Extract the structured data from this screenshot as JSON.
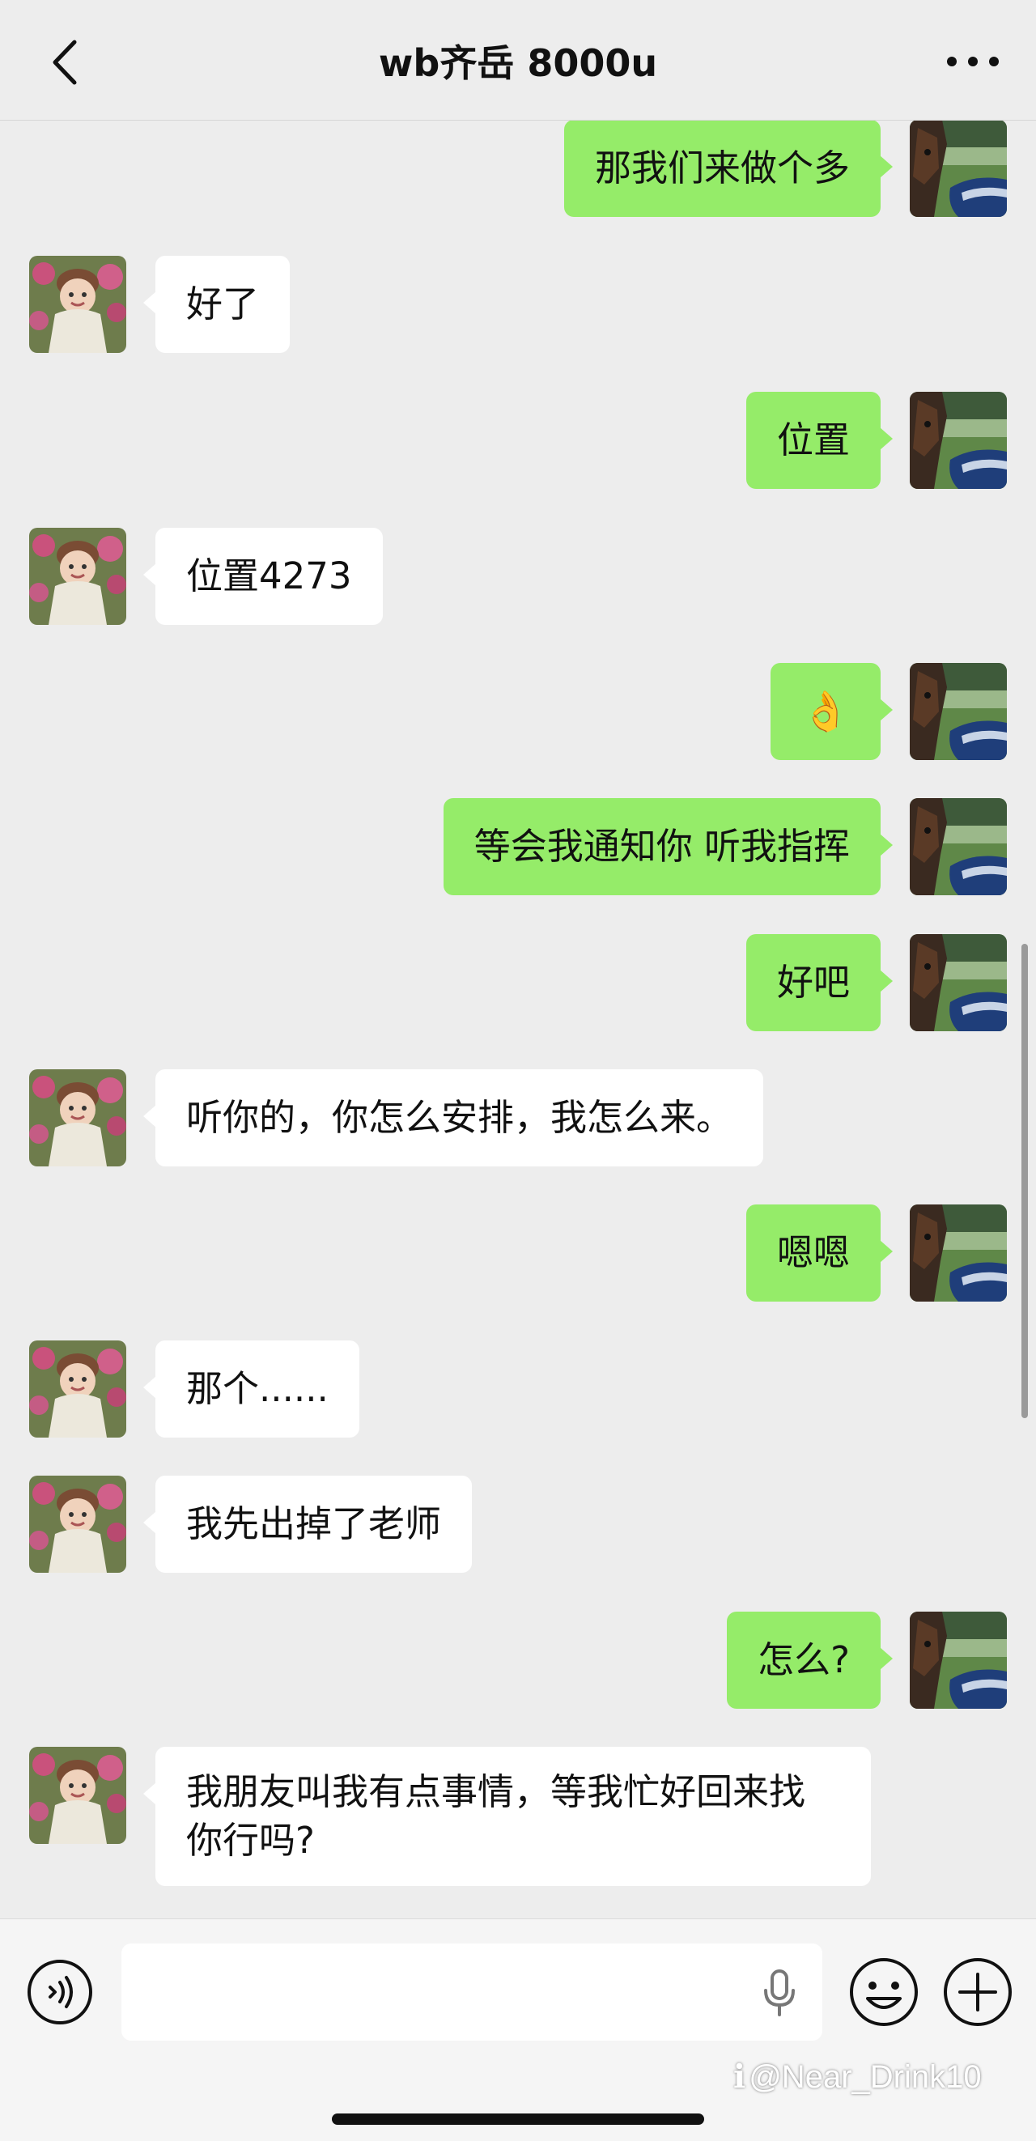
{
  "header": {
    "title": "wb齐岳 8000u"
  },
  "messages": [
    {
      "side": "right",
      "text": "那我们来做个多"
    },
    {
      "side": "left",
      "text": "好了"
    },
    {
      "side": "right",
      "text": "位置"
    },
    {
      "side": "left",
      "text": "位置4273"
    },
    {
      "side": "right",
      "text": "👌"
    },
    {
      "side": "right",
      "text": "等会我通知你 听我指挥"
    },
    {
      "side": "right",
      "text": "好吧"
    },
    {
      "side": "left",
      "text": "听你的，你怎么安排，我怎么来。"
    },
    {
      "side": "right",
      "text": "嗯嗯"
    },
    {
      "side": "left",
      "text": "那个......"
    },
    {
      "side": "left",
      "text": "我先出掉了老师"
    },
    {
      "side": "right",
      "text": "怎么?"
    },
    {
      "side": "left",
      "text": "我朋友叫我有点事情，等我忙好回来找你行吗?"
    }
  ],
  "input": {
    "value": ""
  },
  "watermark": {
    "text": "@Near_Drink10"
  },
  "colors": {
    "sent_bubble": "#95ec69",
    "received_bubble": "#ffffff",
    "background": "#ededed"
  },
  "icons": [
    "back-arrow-icon",
    "more-icon",
    "voice-icon",
    "mic-icon",
    "emoji-icon",
    "plus-icon"
  ]
}
